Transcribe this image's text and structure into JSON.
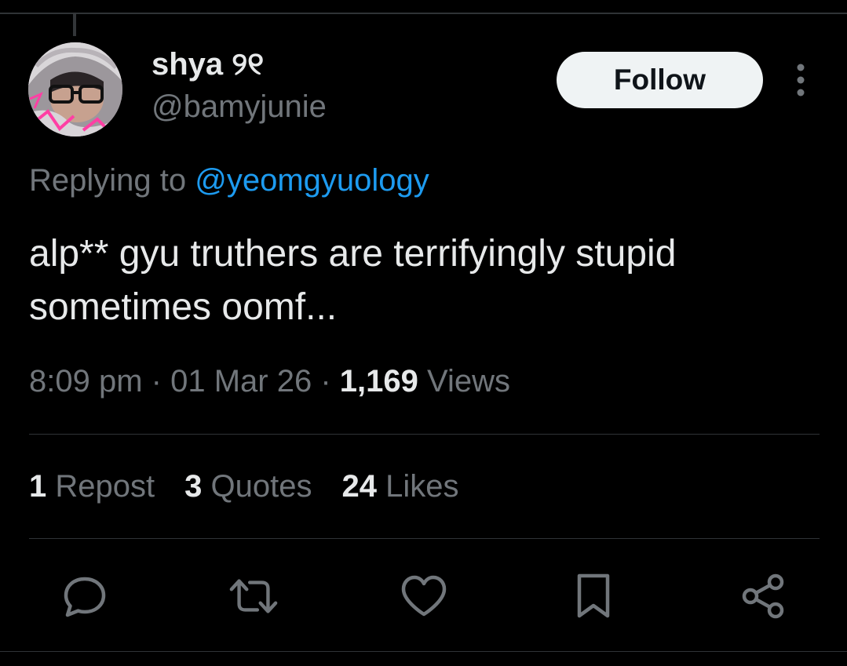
{
  "author": {
    "display_name": "shya ୨୧",
    "handle": "@bamyjunie"
  },
  "follow_label": "Follow",
  "reply": {
    "prefix": "Replying to ",
    "mention": "@yeomgyuology"
  },
  "tweet_text": "alp** gyu truthers are terrifyingly stupid sometimes oomf...",
  "meta": {
    "time": "8:09 pm",
    "separator": "·",
    "date": "01 Mar 26",
    "views_count": "1,169",
    "views_label": "Views"
  },
  "stats": {
    "reposts_count": "1",
    "reposts_label": "Repost",
    "quotes_count": "3",
    "quotes_label": "Quotes",
    "likes_count": "24",
    "likes_label": "Likes"
  },
  "icons": {
    "reply": "reply-icon",
    "repost": "repost-icon",
    "like": "heart-icon",
    "bookmark": "bookmark-icon",
    "share": "share-icon",
    "more": "more-vertical-icon"
  },
  "colors": {
    "background": "#000000",
    "text_primary": "#e7e9ea",
    "text_secondary": "#71767b",
    "accent": "#1d9bf0",
    "follow_bg": "#eff3f4"
  }
}
